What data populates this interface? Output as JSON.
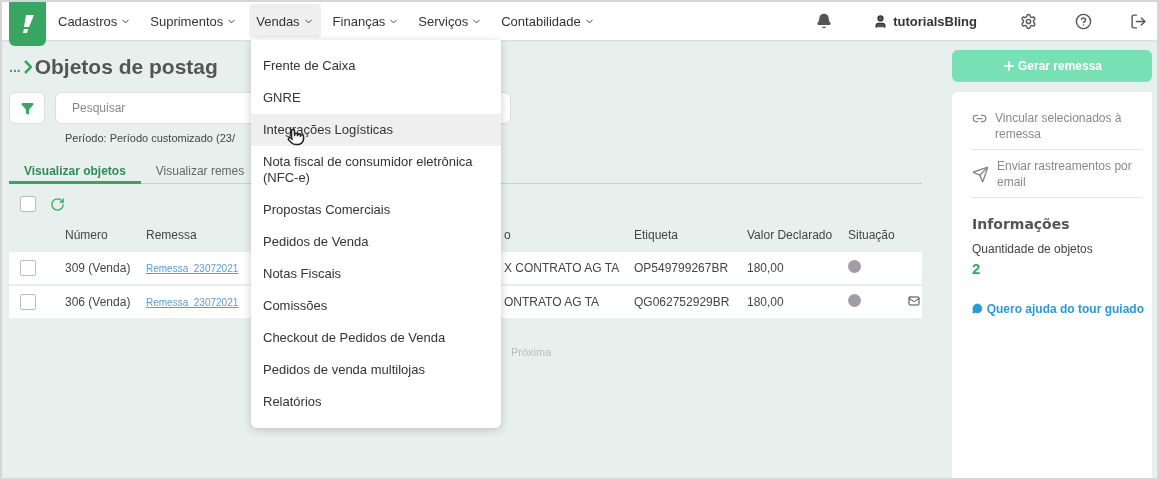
{
  "nav": {
    "menus": [
      {
        "label": "Cadastros",
        "selected": false
      },
      {
        "label": "Suprimentos",
        "selected": false
      },
      {
        "label": "Vendas",
        "selected": true
      },
      {
        "label": "Finanças",
        "selected": false
      },
      {
        "label": "Serviços",
        "selected": false
      },
      {
        "label": "Contabilidade",
        "selected": false
      }
    ],
    "user": "tutorialsBling"
  },
  "dropdown": {
    "items": [
      {
        "label": "Frente de Caixa",
        "highlighted": false
      },
      {
        "label": "GNRE",
        "highlighted": false
      },
      {
        "label": "Integrações Logísticas",
        "highlighted": true
      },
      {
        "label": "Nota fiscal de consumidor eletrônica (NFC-e)",
        "highlighted": false
      },
      {
        "label": "Propostas Comerciais",
        "highlighted": false
      },
      {
        "label": "Pedidos de Venda",
        "highlighted": false
      },
      {
        "label": "Notas Fiscais",
        "highlighted": false
      },
      {
        "label": "Comissões",
        "highlighted": false
      },
      {
        "label": "Checkout de Pedidos de Venda",
        "highlighted": false
      },
      {
        "label": "Pedidos de venda multilojas",
        "highlighted": false
      },
      {
        "label": "Relatórios",
        "highlighted": false
      }
    ]
  },
  "page": {
    "breadcrumb": "...",
    "title": "Objetos de postag",
    "search": {
      "placeholder": "Pesquisar"
    },
    "period": "Período: Período customizado (23/",
    "select_all_checked": false,
    "tabs": [
      {
        "label": "Visualizar objetos",
        "selected": true
      },
      {
        "label": "Visualizar remes",
        "selected": false
      }
    ],
    "table": {
      "columns": [
        "Número",
        "Remessa",
        "o",
        "Etiqueta",
        "Valor Declarado",
        "Situação"
      ],
      "rows": [
        {
          "checked": false,
          "numero": "309 (Venda)",
          "remessa": "Remessa_23072021",
          "column_3": "X CONTRATO AG TA",
          "etiqueta": "OP549799267BR",
          "valor": "180,00",
          "color": "#a39ca8",
          "mail": false
        },
        {
          "checked": false,
          "numero": "306 (Venda)",
          "remessa": "Remessa_23072021",
          "column_3": "ONTRATO AG TA",
          "etiqueta": "QG062752929BR",
          "valor": "180,00",
          "color": "#a39ca8",
          "mail": true
        }
      ]
    },
    "pagination": {
      "next": "Próxima"
    }
  },
  "sidebar": {
    "button": "Gerar remessa",
    "actions": [
      {
        "kind": "link",
        "label": "Vincular selecionados à remessa"
      },
      {
        "kind": "send",
        "label": "Enviar rastreamentos por email"
      }
    ],
    "info_title": "Informações",
    "info_label": "Quantidade de objetos",
    "info_value": "2",
    "help": "Quero ajuda do tour guiado"
  }
}
